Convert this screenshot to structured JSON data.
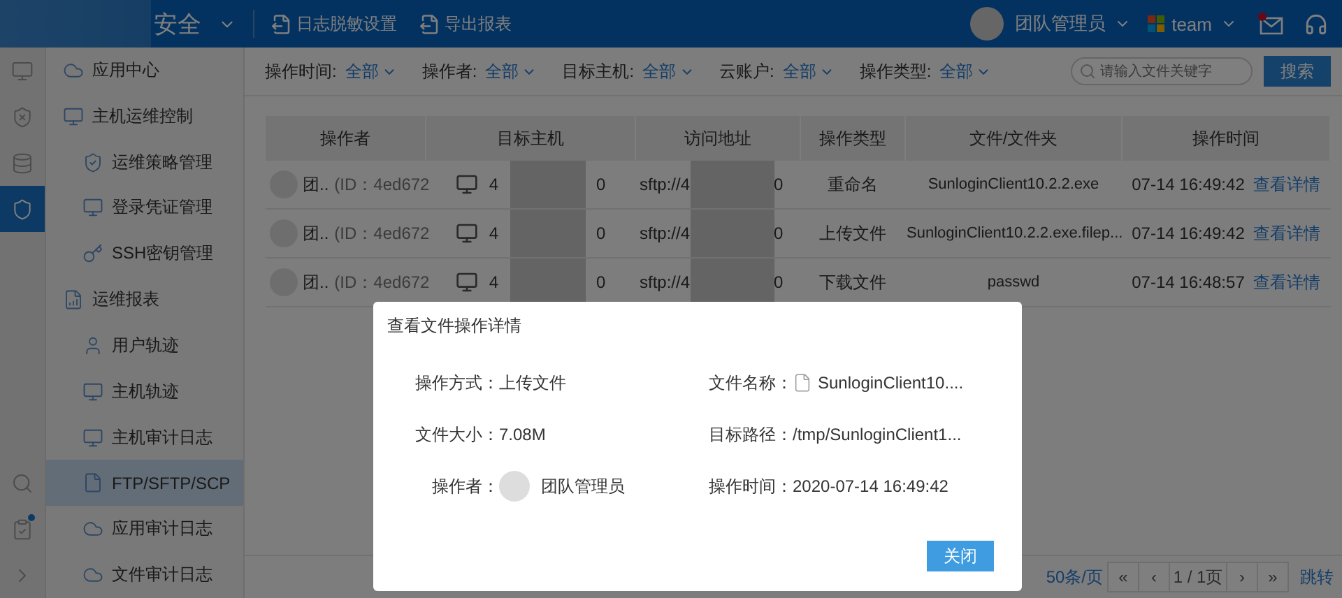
{
  "header": {
    "brand": "安全",
    "actions": [
      {
        "label": "日志脱敏设置"
      },
      {
        "label": "导出报表"
      }
    ],
    "user": "团队管理员",
    "team": "team",
    "mail_unread": true
  },
  "rail": [
    {
      "selected": false
    },
    {
      "selected": false
    },
    {
      "selected": false
    },
    {
      "selected": true
    }
  ],
  "rail_bottom": [
    {
      "badge": false
    },
    {
      "badge": true
    },
    {
      "badge": false
    }
  ],
  "sidebar": {
    "items": [
      {
        "label": "应用中心",
        "selected": false
      },
      {
        "label": "主机运维控制",
        "selected": false,
        "children": [
          {
            "label": "运维策略管理",
            "selected": false
          },
          {
            "label": "登录凭证管理",
            "selected": false
          },
          {
            "label": "SSH密钥管理",
            "selected": false
          }
        ]
      },
      {
        "label": "运维报表",
        "selected": false,
        "children": [
          {
            "label": "用户轨迹",
            "selected": false
          },
          {
            "label": "主机轨迹",
            "selected": false
          },
          {
            "label": "主机审计日志",
            "selected": false
          },
          {
            "label": "FTP/SFTP/SCP",
            "selected": true
          },
          {
            "label": "应用审计日志",
            "selected": false
          },
          {
            "label": "文件审计日志",
            "selected": false
          }
        ]
      }
    ]
  },
  "filters": [
    {
      "label": "操作时间:",
      "value": "全部"
    },
    {
      "label": "操作者:",
      "value": "全部"
    },
    {
      "label": "目标主机:",
      "value": "全部"
    },
    {
      "label": "云账户:",
      "value": "全部"
    },
    {
      "label": "操作类型:",
      "value": "全部"
    }
  ],
  "search": {
    "placeholder": "请输入文件关键字",
    "button": "搜索"
  },
  "table": {
    "columns": [
      "操作者",
      "目标主机",
      "访问地址",
      "操作类型",
      "文件/文件夹",
      "操作时间"
    ],
    "rows": [
      {
        "operator": "团..",
        "operator_id": "(ID：4ed672",
        "host_start": "4",
        "host_end": "0",
        "address_start": "sftp://4",
        "address_end": "0",
        "type": "重命名",
        "file": "SunloginClient10.2.2.exe",
        "time": "07-14 16:49:42",
        "action": "查看详情"
      },
      {
        "operator": "团..",
        "operator_id": "(ID：4ed672",
        "host_start": "4",
        "host_end": "0",
        "address_start": "sftp://4",
        "address_end": "0",
        "type": "上传文件",
        "file": "SunloginClient10.2.2.exe.filep...",
        "time": "07-14 16:49:42",
        "action": "查看详情"
      },
      {
        "operator": "团..",
        "operator_id": "(ID：4ed672",
        "host_start": "4",
        "host_end": "0",
        "address_start": "sftp://4",
        "address_end": "0",
        "type": "下载文件",
        "file": "passwd",
        "time": "07-14 16:48:57",
        "action": "查看详情"
      }
    ]
  },
  "pagination": {
    "page_size": "50条/页",
    "first": "«",
    "prev": "‹",
    "page": "1 / 1页",
    "next": "›",
    "last": "»",
    "jump": "跳转"
  },
  "dialog": {
    "title": "查看文件操作详情",
    "fields": [
      {
        "label": "操作方式：",
        "value": "上传文件",
        "kind": "text"
      },
      {
        "label": "文件名称：",
        "value": "SunloginClient10....",
        "kind": "file"
      },
      {
        "label": "文件大小：",
        "value": "7.08M",
        "kind": "text"
      },
      {
        "label": "目标路径：",
        "value": "/tmp/SunloginClient1...",
        "kind": "text"
      },
      {
        "label": "操作者：",
        "value": "团队管理员",
        "kind": "user"
      },
      {
        "label": "操作时间：",
        "value": "2020-07-14 16:49:42",
        "kind": "text"
      }
    ],
    "button": "关闭"
  }
}
